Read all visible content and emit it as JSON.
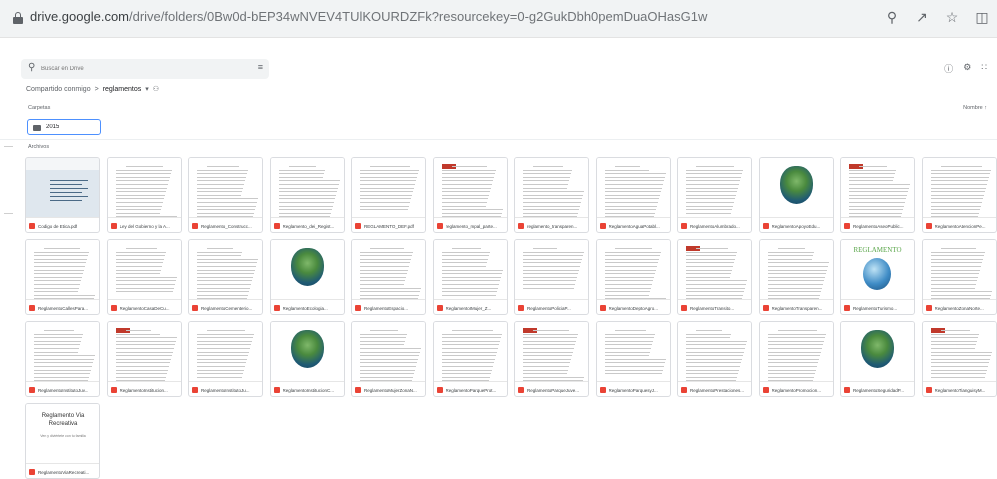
{
  "browser": {
    "url_host": "drive.google.com",
    "url_path": "/drive/folders/0Bw0d-bEP34wNVEV4TUlKOURDZFk?resourcekey=0-g2GukDbh0pemDuaOHasG1w",
    "icons": [
      "zoom-icon",
      "share-icon",
      "star-icon",
      "sidebar-icon"
    ]
  },
  "drive": {
    "search_placeholder": "Buscar en Drive",
    "breadcrumb_root": "Compartido conmigo",
    "breadcrumb_sep": ">",
    "breadcrumb_current": "reglamentos",
    "breadcrumb_caret": "▾",
    "breadcrumb_people": "⚇",
    "folders_label": "Carpetas",
    "sort_label": "Nombre ↑",
    "folder_name": "2015",
    "files_label": "Archivos",
    "files": [
      "Codigo de Etica.pdf",
      "Ley del Gobierno y la A...",
      "Reglamento_Construcc...",
      "Reglamento_dei_Regist...",
      "REGLAMENTO_DEF.pdf",
      "reglamento_mpal_parte...",
      "reglamento_transparen...",
      "ReglamentoAguaPotabl...",
      "ReglamentoAlumbrado...",
      "ReglamentoApoyoEdu...",
      "ReglamentoAseoPublic...",
      "ReglamentoAtencionPe...",
      "ReglamentoCallesPara...",
      "ReglamentoCasaDeCu...",
      "ReglamentoCementerio...",
      "ReglamentoEcologia...",
      "ReglamentoEspacio...",
      "ReglamentoIMujer_Z...",
      "ReglamentoPoliciaP...",
      "ReglamentoDeptoAgro...",
      "ReglamentoTransito...",
      "ReglamentoTransparen...",
      "ReglamentoTurismo...",
      "ReglamentoZonaNorte...",
      "ReglamentoInstitutoJuv...",
      "ReglamentoInstitucion...",
      "ReglamentoInstitutoJu...",
      "ReglamentoInstitucionC...",
      "ReglamentoMujerZonaN...",
      "ReglamentoParqueProt...",
      "ReglamentoParqueJuve...",
      "ReglamentoParquesyJ...",
      "ReglamentoPrestaciones...",
      "ReglamentoPromocion...",
      "ReglamentoSeguridadP...",
      "ReglamentoTianguisyM...",
      "ReglamentoViaRecreati..."
    ],
    "thumb_text": {
      "green_title": "REGLAMENTO",
      "via_title": "Reglamento Via Recreativa",
      "via_sub": "Ven y diviértete con tu familia"
    },
    "colors": {
      "pdf": "#ea4335",
      "selection": "#4d90fe"
    }
  }
}
